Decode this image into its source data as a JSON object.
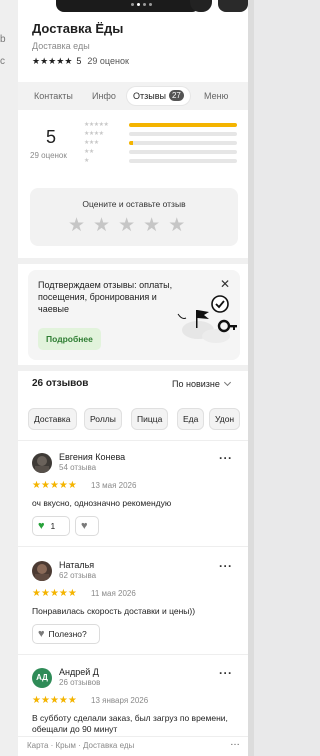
{
  "left_strip": {
    "labels": [
      "",
      "b",
      "с"
    ]
  },
  "gallery": {
    "dots": 4,
    "active_dot": 1
  },
  "org": {
    "title": "Доставка Ёды",
    "category": "Доставка еды",
    "rating": "5",
    "rating_count": "29 оценок"
  },
  "tabs": [
    {
      "label": "Контакты",
      "active": false
    },
    {
      "label": "Инфо",
      "active": false
    },
    {
      "label": "Отзывы",
      "badge": "27",
      "active": true
    },
    {
      "label": "Меню",
      "active": false
    }
  ],
  "summary": {
    "score": "5",
    "count": "29 оценок",
    "distribution": [
      {
        "stars": 5,
        "fraction": 1.0
      },
      {
        "stars": 4,
        "fraction": 0.0
      },
      {
        "stars": 3,
        "fraction": 0.04
      },
      {
        "stars": 2,
        "fraction": 0.0
      },
      {
        "stars": 1,
        "fraction": 0.0
      }
    ]
  },
  "rate_prompt": {
    "label": "Оцените и оставьте отзыв"
  },
  "promo": {
    "text": "Подтверждаем отзывы: оплаты, посещения, бронирования и чаевые",
    "button": "Подробнее"
  },
  "reviews_header": {
    "count": "26 отзывов",
    "sort": "По новизне"
  },
  "filters": [
    "Доставка",
    "Роллы",
    "Пицца",
    "Еда",
    "Удон"
  ],
  "reviews": [
    {
      "name": "Евгения Конева",
      "sub": "54 отзыва",
      "date": "13 мая 2026",
      "text": "оч вкусно, однозначно рекомендую",
      "likes": "1",
      "avatar_color": "#3e3a36",
      "avatar_initials": ""
    },
    {
      "name": "Наталья",
      "sub": "62 отзыва",
      "date": "11 мая 2026",
      "text": "Понравилась скорость доставки и цены))",
      "helpful": "Полезно?",
      "avatar_color": "#4b3a32",
      "avatar_initials": ""
    },
    {
      "name": "Андрей Д",
      "sub": "26 отзывов",
      "date": "13 января 2026",
      "text": "В субботу сделали заказ, был загруз по времени, обещали до 90 минут",
      "avatar_color": "#2e8b57",
      "avatar_initials": "АД"
    }
  ],
  "footer": {
    "breadcrumb": "Карта · Крым · Доставка еды"
  },
  "colors": {
    "accent_star": "#f4b400",
    "brand_green": "#2e7d32"
  }
}
